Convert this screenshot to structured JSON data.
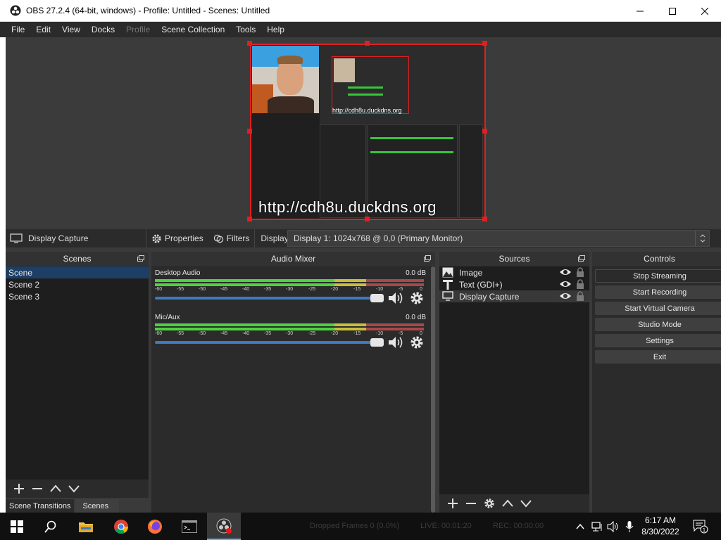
{
  "window": {
    "title": "OBS 27.2.4 (64-bit, windows) - Profile: Untitled - Scenes: Untitled",
    "controls": [
      "minimize",
      "maximize",
      "close"
    ]
  },
  "menu": [
    {
      "label": "File",
      "enabled": true
    },
    {
      "label": "Edit",
      "enabled": true
    },
    {
      "label": "View",
      "enabled": true
    },
    {
      "label": "Docks",
      "enabled": true
    },
    {
      "label": "Profile",
      "enabled": false
    },
    {
      "label": "Scene Collection",
      "enabled": true
    },
    {
      "label": "Tools",
      "enabled": true
    },
    {
      "label": "Help",
      "enabled": true
    }
  ],
  "preview": {
    "overlay_text": "http://cdh8u.duckdns.org",
    "overlay_text_small": "http://cdh8u.duckdns.org"
  },
  "source_toolbar": {
    "selected_source": "Display Capture",
    "properties_label": "Properties",
    "filters_label": "Filters",
    "display_label": "Display",
    "display_value": "Display 1: 1024x768 @ 0,0 (Primary Monitor)"
  },
  "scenes": {
    "title": "Scenes",
    "items": [
      "Scene",
      "Scene 2",
      "Scene 3"
    ],
    "selected_index": 0
  },
  "audio_mixer": {
    "title": "Audio Mixer",
    "ticks": [
      "-60",
      "-55",
      "-50",
      "-45",
      "-40",
      "-35",
      "-30",
      "-25",
      "-20",
      "-15",
      "-10",
      "-5",
      "0"
    ],
    "channels": [
      {
        "name": "Desktop Audio",
        "db": "0.0 dB",
        "volume_fraction": 1.0
      },
      {
        "name": "Mic/Aux",
        "db": "0.0 dB",
        "volume_fraction": 1.0
      }
    ]
  },
  "sources": {
    "title": "Sources",
    "items": [
      {
        "name": "Image",
        "icon": "image-icon",
        "visible": true,
        "locked": true
      },
      {
        "name": "Text (GDI+)",
        "icon": "text-icon",
        "visible": true,
        "locked": true
      },
      {
        "name": "Display Capture",
        "icon": "monitor-icon",
        "visible": true,
        "locked": true
      }
    ],
    "selected_index": 2
  },
  "controls": {
    "title": "Controls",
    "buttons": [
      "Stop Streaming",
      "Start Recording",
      "Start Virtual Camera",
      "Studio Mode",
      "Settings",
      "Exit"
    ]
  },
  "bottom_tabs": [
    "Scene Transitions",
    "Scenes"
  ],
  "taskbar": {
    "status_faded": [
      "Dropped Frames 0 (0.0%)",
      "LIVE: 00:01:20",
      "REC: 00:00:00"
    ],
    "time": "6:17 AM",
    "date": "8/30/2022",
    "notification_count": "1"
  },
  "colors": {
    "accent_selection": "#1d3f66",
    "preview_border": "#e02020",
    "meter_green": "#4cd43e",
    "slider_blue": "#3d7ac0"
  }
}
